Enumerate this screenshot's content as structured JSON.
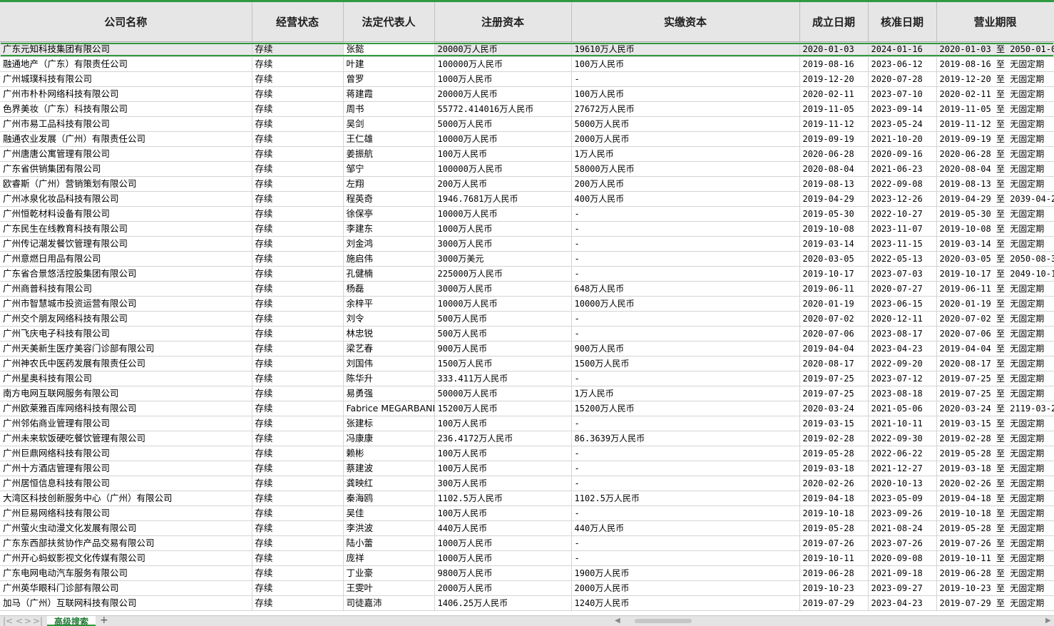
{
  "sheet": {
    "headers": [
      "公司名称",
      "经营状态",
      "法定代表人",
      "注册资本",
      "实缴资本",
      "成立日期",
      "核准日期",
      "营业期限"
    ],
    "rows": [
      [
        "广东元知科技集团有限公司",
        "存续",
        "张懿",
        "20000万人民币",
        "19610万人民币",
        "2020-01-03",
        "2024-01-16",
        "2020-01-03 至 2050-01-0"
      ],
      [
        "融通地产（广东）有限责任公司",
        "存续",
        "叶建",
        "100000万人民币",
        "100万人民币",
        "2019-08-16",
        "2023-06-12",
        "2019-08-16 至 无固定期"
      ],
      [
        "广州城璞科技有限公司",
        "存续",
        "曾罗",
        "1000万人民币",
        "-",
        "2019-12-20",
        "2020-07-28",
        "2019-12-20 至 无固定期"
      ],
      [
        "广州市朴朴网络科技有限公司",
        "存续",
        "蒋建霞",
        "20000万人民币",
        "100万人民币",
        "2020-02-11",
        "2023-07-10",
        "2020-02-11 至 无固定期"
      ],
      [
        "色界美妆（广东）科技有限公司",
        "存续",
        "周书",
        "55772.414016万人民币",
        "27672万人民币",
        "2019-11-05",
        "2023-09-14",
        "2019-11-05 至 无固定期"
      ],
      [
        "广州市易工品科技有限公司",
        "存续",
        "吴剑",
        "5000万人民币",
        "5000万人民币",
        "2019-11-12",
        "2023-05-24",
        "2019-11-12 至 无固定期"
      ],
      [
        "融通农业发展（广州）有限责任公司",
        "存续",
        "王仁雄",
        "10000万人民币",
        "2000万人民币",
        "2019-09-19",
        "2021-10-20",
        "2019-09-19 至 无固定期"
      ],
      [
        "广州唐唐公寓管理有限公司",
        "存续",
        "姜振航",
        "100万人民币",
        "1万人民币",
        "2020-06-28",
        "2020-09-16",
        "2020-06-28 至 无固定期"
      ],
      [
        "广东省供销集团有限公司",
        "存续",
        "邹宁",
        "100000万人民币",
        "58000万人民币",
        "2020-08-04",
        "2021-06-23",
        "2020-08-04 至 无固定期"
      ],
      [
        "欧睿斯（广州）营销策划有限公司",
        "存续",
        "左翔",
        "200万人民币",
        "200万人民币",
        "2019-08-13",
        "2022-09-08",
        "2019-08-13 至 无固定期"
      ],
      [
        "广州冰泉化妆品科技有限公司",
        "存续",
        "程英奇",
        "1946.7681万人民币",
        "400万人民币",
        "2019-04-29",
        "2023-12-26",
        "2019-04-29 至 2039-04-2"
      ],
      [
        "广州恒乾材料设备有限公司",
        "存续",
        "徐保亭",
        "10000万人民币",
        "-",
        "2019-05-30",
        "2022-10-27",
        "2019-05-30 至 无固定期"
      ],
      [
        "广东民生在线教育科技有限公司",
        "存续",
        "李建东",
        "1000万人民币",
        "-",
        "2019-10-08",
        "2023-11-07",
        "2019-10-08 至 无固定期"
      ],
      [
        "广州传记潮发餐饮管理有限公司",
        "存续",
        "刘金鸿",
        "3000万人民币",
        "-",
        "2019-03-14",
        "2023-11-15",
        "2019-03-14 至 无固定期"
      ],
      [
        "广州意燃日用品有限公司",
        "存续",
        "施启伟",
        "3000万美元",
        "-",
        "2020-03-05",
        "2022-05-13",
        "2020-03-05 至 2050-08-3"
      ],
      [
        "广东省合景悠活控股集团有限公司",
        "存续",
        "孔健楠",
        "225000万人民币",
        "-",
        "2019-10-17",
        "2023-07-03",
        "2019-10-17 至 2049-10-1"
      ],
      [
        "广州商普科技有限公司",
        "存续",
        "杨磊",
        "3000万人民币",
        "648万人民币",
        "2019-06-11",
        "2020-07-27",
        "2019-06-11 至 无固定期"
      ],
      [
        "广州市智慧城市投资运营有限公司",
        "存续",
        "余梓平",
        "10000万人民币",
        "10000万人民币",
        "2020-01-19",
        "2023-06-15",
        "2020-01-19 至 无固定期"
      ],
      [
        "广州交个朋友网络科技有限公司",
        "存续",
        "刘令",
        "500万人民币",
        "-",
        "2020-07-02",
        "2020-12-11",
        "2020-07-02 至 无固定期"
      ],
      [
        "广州飞庆电子科技有限公司",
        "存续",
        "林忠锐",
        "500万人民币",
        "-",
        "2020-07-06",
        "2023-08-17",
        "2020-07-06 至 无固定期"
      ],
      [
        "广州天美新生医疗美容门诊部有限公司",
        "存续",
        "梁艺春",
        "900万人民币",
        "900万人民币",
        "2019-04-04",
        "2023-04-23",
        "2019-04-04 至 无固定期"
      ],
      [
        "广州神农氏中医药发展有限责任公司",
        "存续",
        "刘国伟",
        "1500万人民币",
        "1500万人民币",
        "2020-08-17",
        "2022-09-20",
        "2020-08-17 至 无固定期"
      ],
      [
        "广州星奥科技有限公司",
        "存续",
        "陈华升",
        "333.411万人民币",
        "-",
        "2019-07-25",
        "2023-07-12",
        "2019-07-25 至 无固定期"
      ],
      [
        "南方电网互联网服务有限公司",
        "存续",
        "易勇强",
        "50000万人民币",
        "1万人民币",
        "2019-07-25",
        "2023-08-18",
        "2019-07-25 至 无固定期"
      ],
      [
        "广州欧莱雅百库网络科技有限公司",
        "存续",
        "Fabrice MEGARBANE",
        "15200万人民币",
        "15200万人民币",
        "2020-03-24",
        "2021-05-06",
        "2020-03-24 至 2119-03-2"
      ],
      [
        "广州邻佑商业管理有限公司",
        "存续",
        "张建标",
        "100万人民币",
        "-",
        "2019-03-15",
        "2021-10-11",
        "2019-03-15 至 无固定期"
      ],
      [
        "广州未来软饭硬吃餐饮管理有限公司",
        "存续",
        "冯康康",
        "236.4172万人民币",
        "86.3639万人民币",
        "2019-02-28",
        "2022-09-30",
        "2019-02-28 至 无固定期"
      ],
      [
        "广州巨鼎网络科技有限公司",
        "存续",
        "赖彬",
        "100万人民币",
        "-",
        "2019-05-28",
        "2022-06-22",
        "2019-05-28 至 无固定期"
      ],
      [
        "广州十方酒店管理有限公司",
        "存续",
        "蔡建波",
        "100万人民币",
        "-",
        "2019-03-18",
        "2021-12-27",
        "2019-03-18 至 无固定期"
      ],
      [
        "广州居恒信息科技有限公司",
        "存续",
        "龚映红",
        "300万人民币",
        "-",
        "2020-02-26",
        "2020-10-13",
        "2020-02-26 至 无固定期"
      ],
      [
        "大湾区科技创新服务中心（广州）有限公司",
        "存续",
        "秦海鸥",
        "1102.5万人民币",
        "1102.5万人民币",
        "2019-04-18",
        "2023-05-09",
        "2019-04-18 至 无固定期"
      ],
      [
        "广州巨易网络科技有限公司",
        "存续",
        "吴佳",
        "100万人民币",
        "-",
        "2019-10-18",
        "2023-09-26",
        "2019-10-18 至 无固定期"
      ],
      [
        "广州萤火虫动漫文化发展有限公司",
        "存续",
        "李洪波",
        "440万人民币",
        "440万人民币",
        "2019-05-28",
        "2021-08-24",
        "2019-05-28 至 无固定期"
      ],
      [
        "广东东西部扶贫协作产品交易有限公司",
        "存续",
        "陆小蕾",
        "1000万人民币",
        "-",
        "2019-07-26",
        "2023-07-26",
        "2019-07-26 至 无固定期"
      ],
      [
        "广州开心蚂蚁影视文化传媒有限公司",
        "存续",
        "庞祥",
        "1000万人民币",
        "-",
        "2019-10-11",
        "2020-09-08",
        "2019-10-11 至 无固定期"
      ],
      [
        "广东电网电动汽车服务有限公司",
        "存续",
        "丁业豪",
        "9800万人民币",
        "1900万人民币",
        "2019-06-28",
        "2021-09-18",
        "2019-06-28 至 无固定期"
      ],
      [
        "广州英华眼科门诊部有限公司",
        "存续",
        "王雯叶",
        "2000万人民币",
        "2000万人民币",
        "2019-10-23",
        "2023-09-27",
        "2019-10-23 至 无固定期"
      ],
      [
        "加马（广州）互联网科技有限公司",
        "存续",
        "司徒嘉沛",
        "1406.25万人民币",
        "1240万人民币",
        "2019-07-29",
        "2023-04-23",
        "2019-07-29 至 无固定期"
      ]
    ]
  },
  "tabs": {
    "active": "高级搜索",
    "add": "+"
  },
  "nav": {
    "first": "|<",
    "prev": "<",
    "next": ">",
    "last": ">|"
  },
  "colors": {
    "accent": "#2f9a3f",
    "header_bg": "#e6e6e6"
  }
}
